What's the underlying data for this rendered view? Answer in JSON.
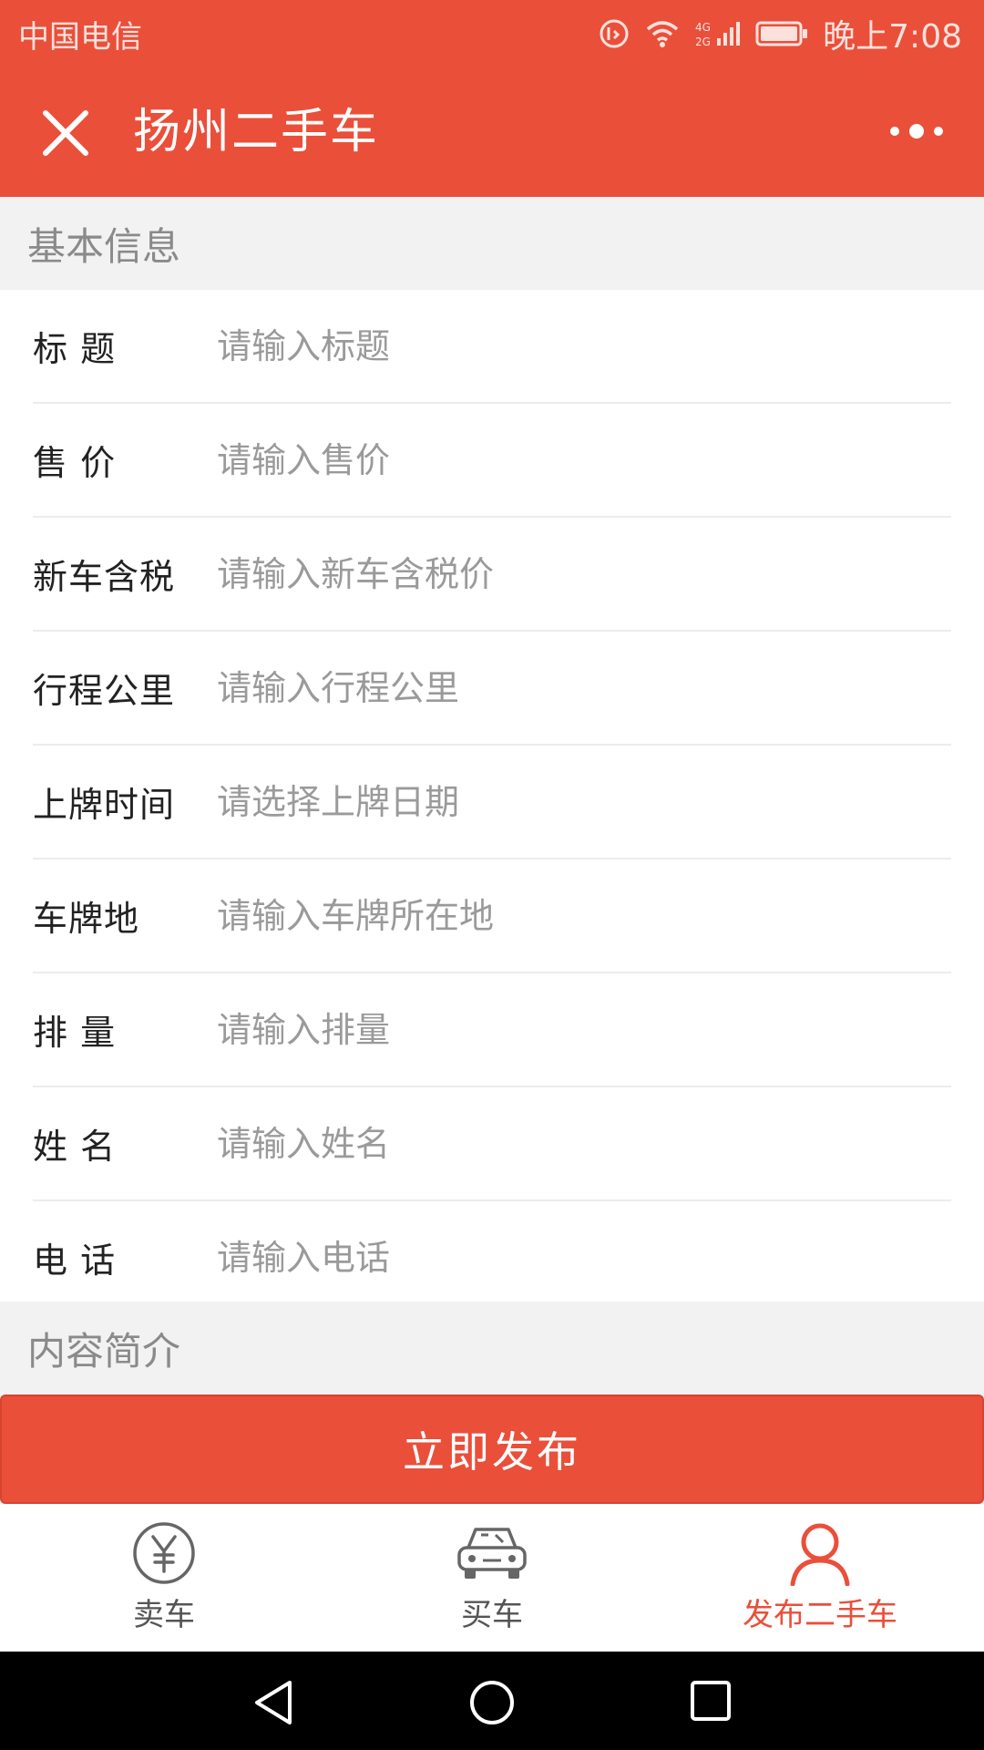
{
  "status_bar": {
    "carrier": "中国电信",
    "time": "晚上7:08",
    "network": "4G 2G"
  },
  "nav": {
    "title": "扬州二手车"
  },
  "basic_section": {
    "title": "基本信息"
  },
  "form": {
    "rows": [
      {
        "label": "标 题",
        "placeholder": "请输入标题"
      },
      {
        "label": "售 价",
        "placeholder": "请输入售价"
      },
      {
        "label": "新车含税",
        "placeholder": "请输入新车含税价"
      },
      {
        "label": "行程公里",
        "placeholder": "请输入行程公里"
      },
      {
        "label": "上牌时间",
        "placeholder": "请选择上牌日期"
      },
      {
        "label": "车牌地",
        "placeholder": "请输入车牌所在地"
      },
      {
        "label": "排 量",
        "placeholder": "请输入排量"
      },
      {
        "label": "姓 名",
        "placeholder": "请输入姓名"
      },
      {
        "label": "电 话",
        "placeholder": "请输入电话"
      }
    ]
  },
  "intro_section": {
    "title": "内容简介"
  },
  "publish_button": {
    "label": "立即发布"
  },
  "tabs": [
    {
      "label": "卖车",
      "icon": "yuan-circle-icon",
      "active": false
    },
    {
      "label": "买车",
      "icon": "car-icon",
      "active": false
    },
    {
      "label": "发布二手车",
      "icon": "person-icon",
      "active": true
    }
  ],
  "colors": {
    "accent": "#ea4f3a",
    "inactive_tab": "#555555",
    "placeholder": "#9a9a9a"
  }
}
